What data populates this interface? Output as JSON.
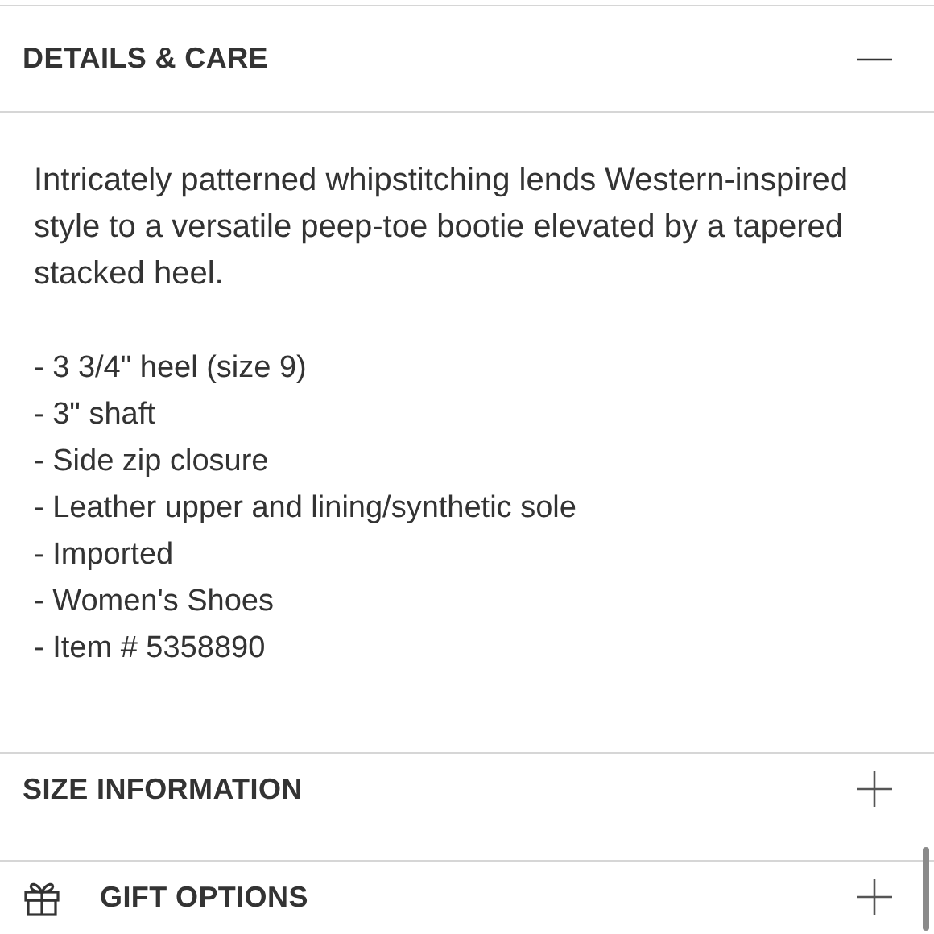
{
  "sections": [
    {
      "title": "DETAILS & CARE",
      "kind": "plain",
      "expanded": true,
      "description": "Intricately patterned whipstitching lends Western-inspired style to a versatile peep-toe bootie elevated by a tapered stacked heel.",
      "details": [
        "- 3 3/4\" heel (size 9)",
        "- 3\" shaft",
        "- Side zip closure",
        "- Leather upper and lining/synthetic sole",
        "- Imported",
        "- Women's Shoes",
        "- Item # 5358890"
      ]
    },
    {
      "title": "SIZE INFORMATION",
      "kind": "plain",
      "expanded": false
    },
    {
      "title": "GIFT OPTIONS",
      "kind": "gift",
      "expanded": false
    }
  ]
}
